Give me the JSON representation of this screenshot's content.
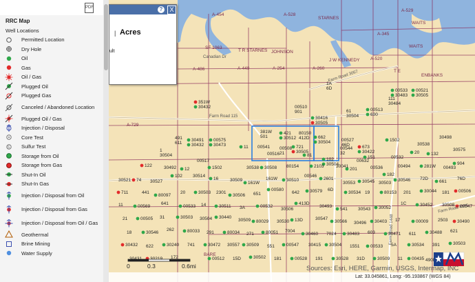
{
  "sidebar": {
    "pdf_icon_text": "PDF",
    "title": "RRC Map",
    "subtitle": "Well Locations",
    "legend": [
      {
        "label": "Permitted Location",
        "icon": "permitted-location-icon"
      },
      {
        "label": "Dry Hole",
        "icon": "dry-hole-icon"
      },
      {
        "label": "Oil",
        "icon": "oil-icon"
      },
      {
        "label": "Gas",
        "icon": "gas-icon"
      },
      {
        "label": "Oil / Gas",
        "icon": "oil-gas-icon"
      },
      {
        "label": "Plugged Oil",
        "icon": "plugged-oil-icon"
      },
      {
        "label": "Plugged Gas",
        "icon": "plugged-gas-icon"
      },
      {
        "label": "Canceled / Abandoned Location",
        "icon": "canceled-location-icon"
      },
      {
        "label": "Plugged Oil / Gas",
        "icon": "plugged-oil-gas-icon"
      },
      {
        "label": "Injection / Disposal",
        "icon": "injection-disposal-icon"
      },
      {
        "label": "Core Test",
        "icon": "core-test-icon"
      },
      {
        "label": "Sulfur Test",
        "icon": "sulfur-test-icon"
      },
      {
        "label": "Storage from Oil",
        "icon": "storage-oil-icon"
      },
      {
        "label": "Storage from Gas",
        "icon": "storage-gas-icon"
      },
      {
        "label": "Shut-In Oil",
        "icon": "shut-in-oil-icon"
      },
      {
        "label": "Shut-In Gas",
        "icon": "shut-in-gas-icon"
      },
      {
        "label": "Injection / Disposal from Oil",
        "icon": "injection-from-oil-icon"
      },
      {
        "label": "Injection / Disposal from Gas",
        "icon": "injection-from-gas-icon"
      },
      {
        "label": "Injection / Disposal from Oil / Gas",
        "icon": "injection-from-oil-gas-icon"
      },
      {
        "label": "Geothermal",
        "icon": "geothermal-icon"
      },
      {
        "label": "Brine Mining",
        "icon": "brine-mining-icon"
      },
      {
        "label": "Water Supply",
        "icon": "water-supply-icon"
      }
    ]
  },
  "popup": {
    "title": "Acres",
    "separator": "|",
    "result_fragment": "ult",
    "help": "?",
    "close": "X"
  },
  "map": {
    "survey_labels": [
      "A-454",
      "A-528",
      "STARNES",
      "WAITS",
      "A-529",
      "A-345",
      "SF 1063",
      "T R STARNES",
      "JOHNSON",
      "WAITS",
      "A-486",
      "A-449",
      "A-254",
      "A-260",
      "A-520",
      "J W KENNEDY",
      "T E",
      "ENBANKS",
      "A-729",
      "BARE"
    ],
    "road_labels": [
      "Farm Road 3067",
      "Farm Road 115",
      "Farm Road 1448",
      "Farm Road 4395",
      "Canadian Dr"
    ],
    "well_labels": [
      "351W",
      "00510",
      "30416",
      "61",
      "00513",
      "111",
      "00533",
      "1A",
      "00521",
      "491",
      "30491",
      "1",
      "00575",
      "381W",
      "421",
      "80150",
      "662",
      "00527",
      "673",
      "00544",
      "721",
      "00508",
      "102",
      "00632",
      "81",
      "00516",
      "11",
      "00541",
      "151",
      "00532",
      "1502",
      "30538",
      "20",
      "30498",
      "132",
      "30575",
      "122",
      "30492",
      "12",
      "00517",
      "1502",
      "30538",
      "30508",
      "80154",
      "2103",
      "30041",
      "201",
      "00536",
      "182",
      "00494",
      "281W",
      "00493",
      "904",
      "30521",
      "74",
      "30527",
      "102",
      "30514",
      "16",
      "30509",
      "161W",
      "161W",
      "30510",
      "00546",
      "2601",
      "30553",
      "30545",
      "30503",
      "30546",
      "72D",
      "661",
      "76D",
      "711",
      "441",
      "80097",
      "20",
      "30503",
      "2301",
      "30506",
      "651",
      "00580",
      "642",
      "30579",
      "6D",
      "30534",
      "19",
      "80153",
      "201",
      "30044",
      "181",
      "00506",
      "11",
      "00569",
      "641",
      "00533",
      "14",
      "30511",
      "3A",
      "00532",
      "30506",
      "413D",
      "30493",
      "541",
      "30543",
      "30052",
      "1C",
      "30452",
      "30508",
      "00547",
      "21",
      "00505",
      "31",
      "30503",
      "30504",
      "30440",
      "30509",
      "80029",
      "30530",
      "13D",
      "30547",
      "30566",
      "30496",
      "30403",
      "17",
      "00009",
      "2503",
      "30490",
      "18",
      "30546",
      "262",
      "80033",
      "291",
      "80034",
      "271",
      "80051",
      "7004",
      "30460",
      "7024",
      "30483",
      "603",
      "30471",
      "611",
      "30488",
      "621",
      "30432",
      "622",
      "30240",
      "741",
      "30472",
      "30557",
      "30509",
      "551",
      "00547",
      "30415",
      "30504",
      "1551",
      "00533",
      "5A",
      "30534",
      "391",
      "30503",
      "30431",
      "30219",
      "172",
      "00512",
      "15D",
      "30502",
      "181",
      "00528",
      "191",
      "30528",
      "31D",
      "30509",
      "11",
      "00435",
      "490E",
      "80164",
      "492T",
      "30432",
      "901",
      "30505",
      "30504",
      "600",
      "30484",
      "30483",
      "6D",
      "30505",
      "611",
      "30432",
      "30504",
      "30473",
      "501",
      "30512",
      "412D",
      "30504",
      "46D",
      "30422",
      "32",
      "30505",
      "21",
      "30504"
    ],
    "attribution": "Sources: Esri, HERE, Garmin, USGS, Intermap, INC",
    "scale_labels": [
      "0",
      "0.3",
      "0.6mi"
    ],
    "coords_text": "Lat: 33.045861, Long: -95.193867 (WGS 84)",
    "colors": {
      "land": "#f4e3b8",
      "water": "#8fb4de",
      "survey": "#8a2a5a",
      "oil": "#2fa84a",
      "gas": "#e22b2b",
      "selection": "#2a7fe0"
    }
  }
}
